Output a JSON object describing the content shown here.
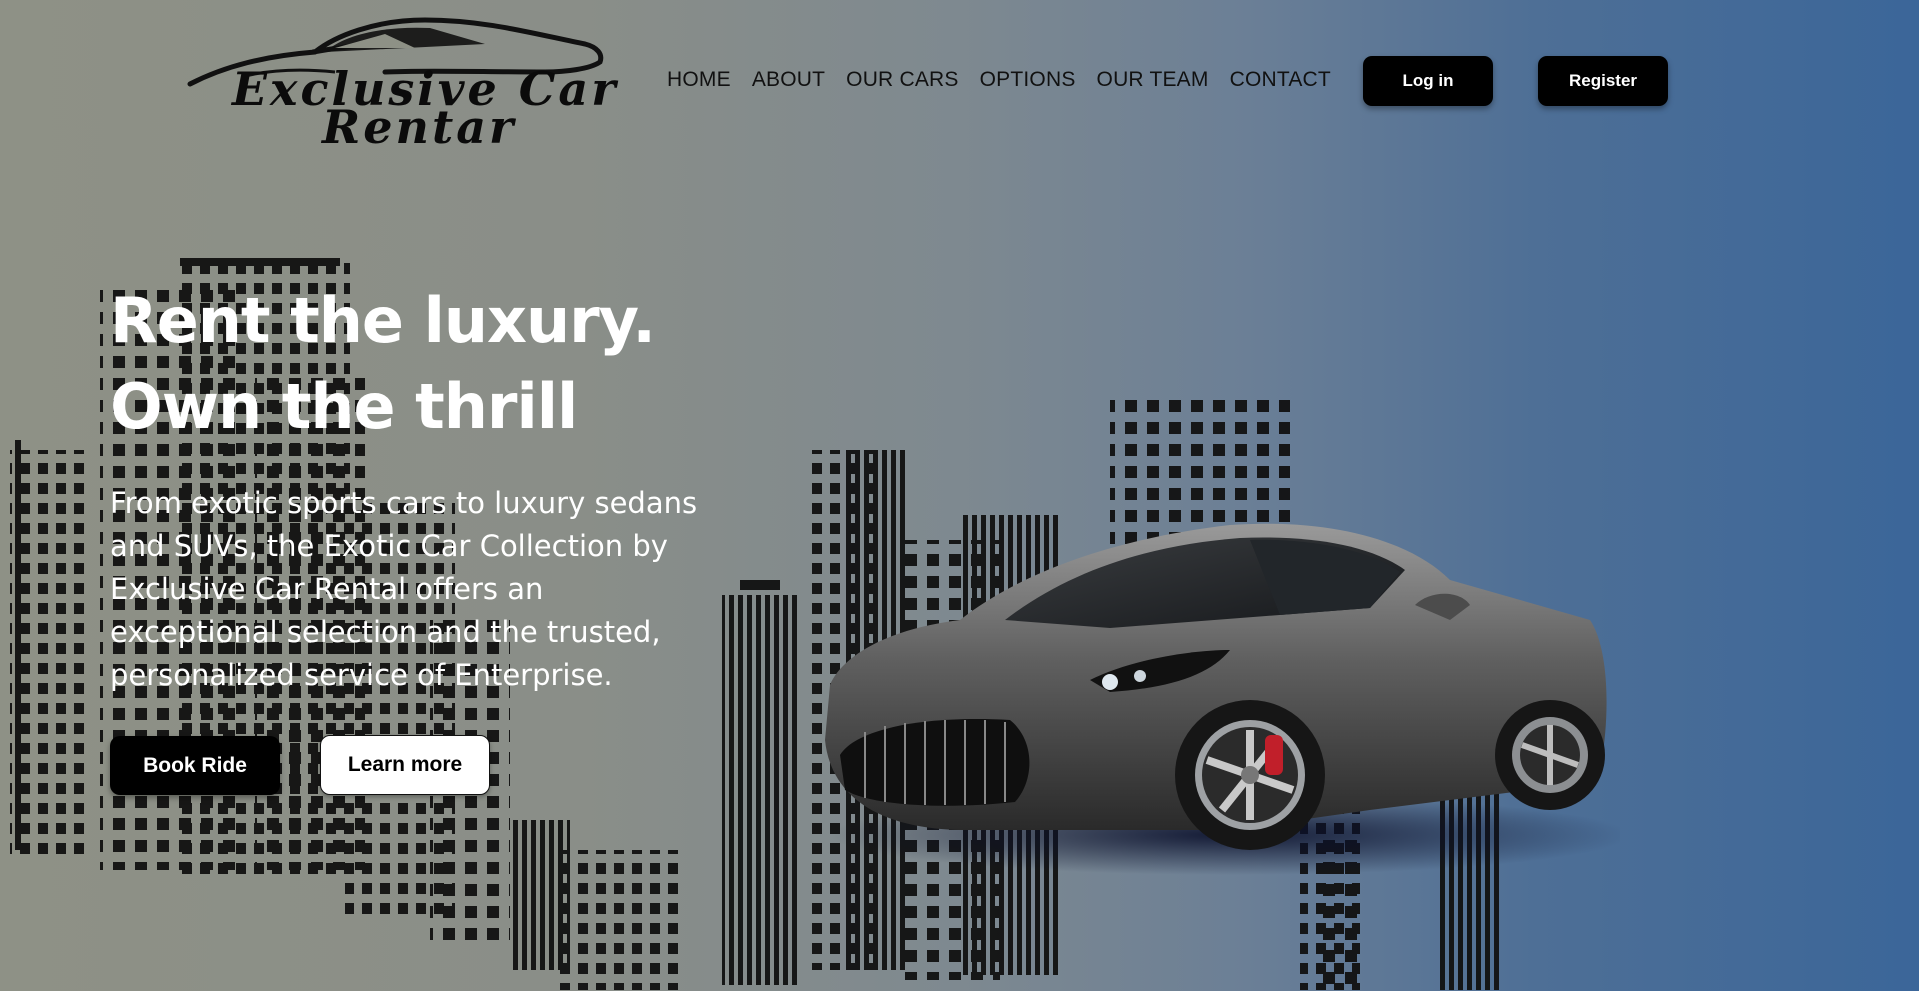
{
  "brand": {
    "name_line1": "Exclusive Car",
    "name_line2": "Rentar"
  },
  "nav": [
    "HOME",
    "ABOUT",
    "OUR CARS",
    "OPTIONS",
    "OUR TEAM",
    "CONTACT"
  ],
  "auth": {
    "login_label": "Log in",
    "register_label": "Register"
  },
  "hero": {
    "title_line1": "Rent the luxury.",
    "title_line2": "Own the thrill",
    "description": "From exotic sports cars to luxury sedans and SUVs, the Exotic Car Collection by Exclusive Car Rental offers an exceptional selection and the trusted, personalized service of Enterprise.",
    "book_label": "Book Ride",
    "learn_label": "Learn more"
  },
  "colors": {
    "gradient_left": "#8e9186",
    "gradient_right": "#3b6699",
    "button_dark": "#000000",
    "text_light": "#ffffff"
  }
}
